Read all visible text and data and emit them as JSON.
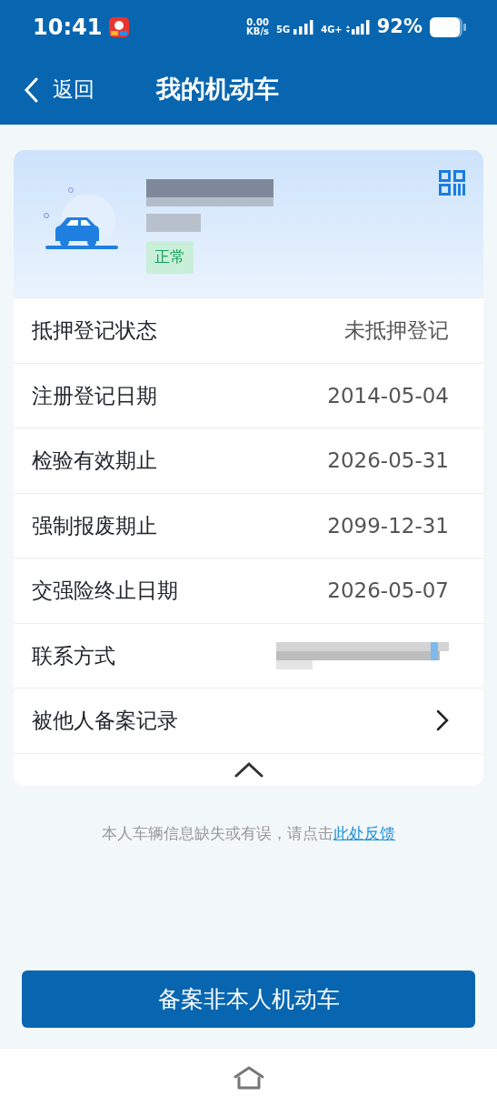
{
  "status_bar": {
    "time": "10:41",
    "net_speed": "0.00",
    "net_unit": "KB/s",
    "sim1": "5G",
    "sim2": "4G+",
    "battery": "92%"
  },
  "header": {
    "back": "返回",
    "title": "我的机动车"
  },
  "vehicle": {
    "status": "正常"
  },
  "rows": [
    {
      "kind": "value",
      "label": "抵押登记状态",
      "value": "未抵押登记"
    },
    {
      "kind": "value",
      "label": "注册登记日期",
      "value": "2014-05-04"
    },
    {
      "kind": "value",
      "label": "检验有效期止",
      "value": "2026-05-31"
    },
    {
      "kind": "value",
      "label": "强制报废期止",
      "value": "2099-12-31"
    },
    {
      "kind": "value",
      "label": "交强险终止日期",
      "value": "2026-05-07"
    },
    {
      "kind": "redacted",
      "label": "联系方式"
    },
    {
      "kind": "link",
      "label": "被他人备案记录"
    }
  ],
  "feedback": {
    "text": "本人车辆信息缺失或有误，请点击",
    "link": "此处反馈"
  },
  "button": "备案非本人机动车"
}
